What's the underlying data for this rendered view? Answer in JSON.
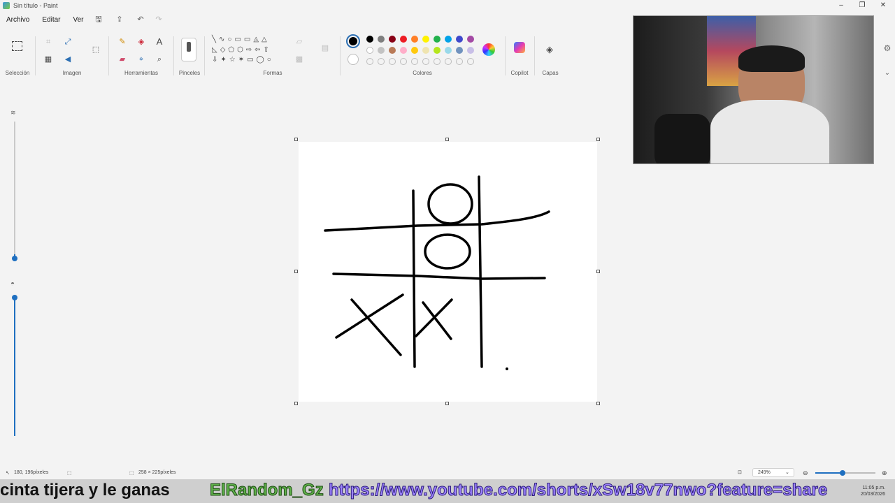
{
  "window": {
    "title": "Sin título - Paint"
  },
  "menu": {
    "items": [
      "Archivo",
      "Editar",
      "Ver"
    ]
  },
  "ribbon": {
    "groups": {
      "seleccion": "Selección",
      "imagen": "Imagen",
      "herramientas": "Herramientas",
      "pinceles": "Pinceles",
      "formas": "Formas",
      "colores": "Colores",
      "copilot": "Copilot",
      "capas": "Capas"
    },
    "tool_glyph_text": "A",
    "palette_row1": [
      "#000000",
      "#7f7f7f",
      "#880015",
      "#ed1c24",
      "#ff7f27",
      "#fff200",
      "#22b14c",
      "#00a2e8",
      "#3f48cc",
      "#a349a4"
    ],
    "palette_row2": [
      "#ffffff",
      "#c3c3c3",
      "#b97a57",
      "#ffaec9",
      "#ffc90e",
      "#efe4b0",
      "#b5e61d",
      "#99d9ea",
      "#7092be",
      "#c8bfe7"
    ],
    "active_color": "#000000"
  },
  "status": {
    "cursor_pos": "180, 196píxeles",
    "canvas_size": "258 × 225píxeles",
    "zoom": "249%",
    "zoom_level": 0.45
  },
  "overlay": {
    "caption": "cinta tijera y le ganas",
    "channel": "ElRandom_Gz",
    "link": "https://www.youtube.com/shorts/xSw18v77nwo?feature=share",
    "clock_time": "11:05 p.m.",
    "clock_date": "20/03/2026"
  }
}
